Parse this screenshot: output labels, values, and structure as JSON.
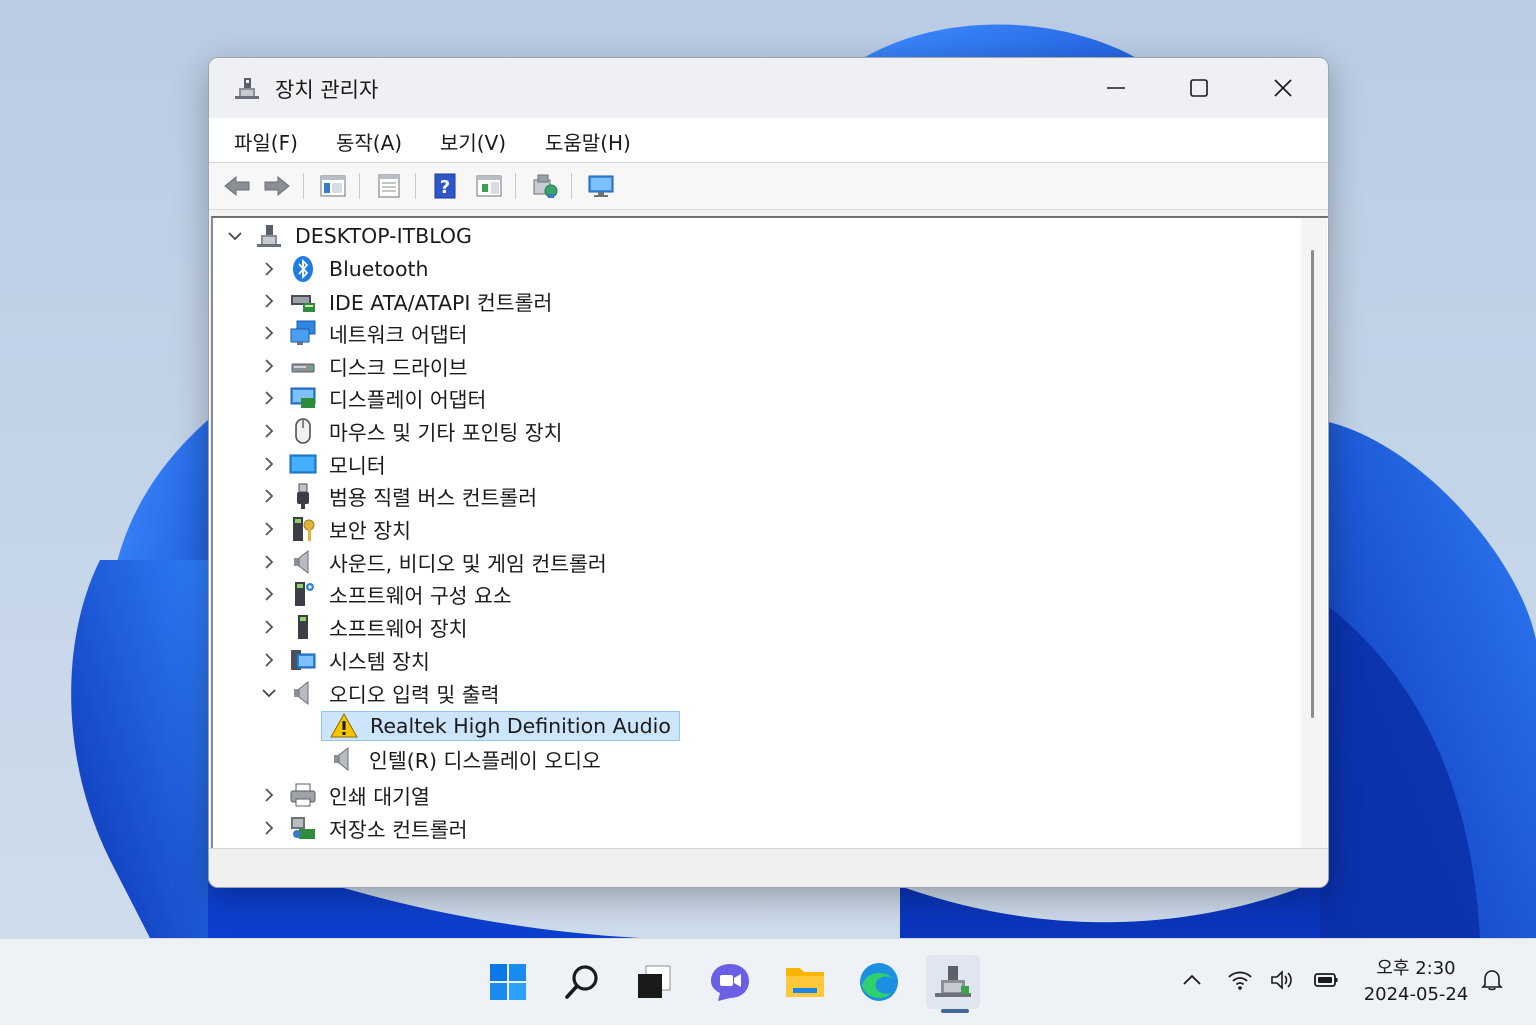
{
  "window": {
    "title": "장치 관리자",
    "controls": [
      "minimize",
      "maximize",
      "close"
    ]
  },
  "menubar": [
    {
      "label": "파일(F)"
    },
    {
      "label": "동작(A)"
    },
    {
      "label": "보기(V)"
    },
    {
      "label": "도움말(H)"
    }
  ],
  "toolbar": {
    "buttons": [
      "back-arrow-icon",
      "forward-arrow-icon",
      "show-hide-console-icon",
      "properties-icon",
      "help-icon",
      "action-pane-icon",
      "scan-hardware-icon",
      "monitor-icon"
    ]
  },
  "tree": {
    "root": "DESKTOP-ITBLOG",
    "categories": [
      "Bluetooth",
      "IDE ATA/ATAPI 컨트롤러",
      "네트워크 어댑터",
      "디스크 드라이브",
      "디스플레이 어댑터",
      "마우스 및 기타 포인팅 장치",
      "모니터",
      "범용 직렬 버스 컨트롤러",
      "보안 장치",
      "사운드, 비디오 및 게임 컨트롤러",
      "소프트웨어 구성 요소",
      "소프트웨어 장치",
      "시스템 장치",
      "오디오 입력 및 출력",
      "인쇄 대기열",
      "저장소 컨트롤러"
    ],
    "audio_children": [
      "Realtek High Definition Audio",
      "인텔(R) 디스플레이 오디오"
    ],
    "selected": "Realtek High Definition Audio"
  },
  "taskbar": {
    "apps": [
      "windows-start-icon",
      "search-icon",
      "task-view-icon",
      "chat-icon",
      "file-explorer-icon",
      "edge-browser-icon",
      "device-manager-icon"
    ]
  },
  "clock": {
    "time": "오후 2:30",
    "date": "2024-05-24"
  },
  "colors": {
    "selection": "#cde5fa",
    "accent": "#0067c0",
    "warning": "#f5c400"
  }
}
